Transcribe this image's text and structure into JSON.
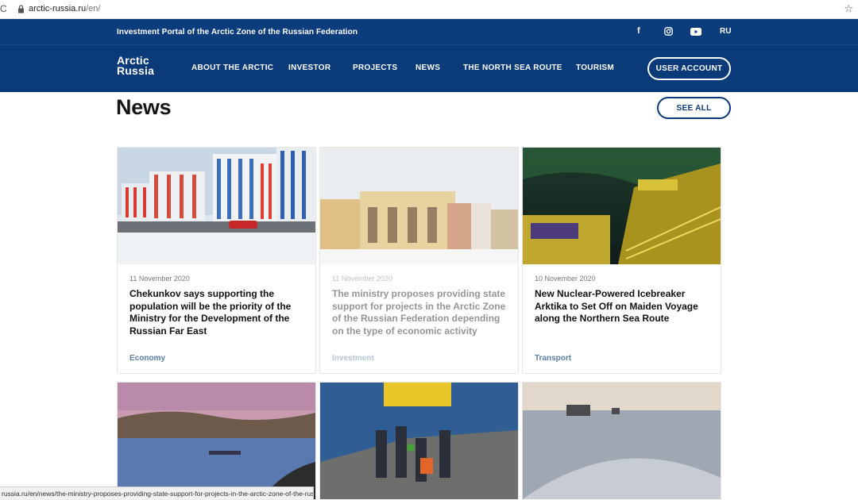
{
  "browser": {
    "url_host": "arctic-russia.ru",
    "url_path": "/en/",
    "status_url": "russia.ru/en/news/the-ministry-proposes-providing-state-support-for-projects-in-the-arctic-zone-of-the-russian-federat/"
  },
  "header": {
    "portal_title": "Investment Portal of the Arctic Zone of the Russian Federation",
    "social": [
      "f",
      "instagram-icon",
      "youtube-icon"
    ],
    "lang": "RU",
    "logo_line1": "Arctic",
    "logo_line2": "Russia",
    "nav": [
      {
        "label": "ABOUT THE ARCTIC"
      },
      {
        "label": "INVESTOR"
      },
      {
        "label": "PROJECTS"
      },
      {
        "label": "NEWS"
      },
      {
        "label": "THE NORTH SEA ROUTE"
      },
      {
        "label": "TOURISM"
      }
    ],
    "account_label": "USER ACCOUNT",
    "colors": {
      "header_bg": "#0a3a78",
      "tag": "#5b7ea3"
    }
  },
  "news": {
    "title": "News",
    "see_all": "SEE ALL",
    "cards": [
      {
        "date": "11 November 2020",
        "title": "Chekunkov says supporting the population will be the priority of the Ministry for the Development of the Russian Far East",
        "tag": "Economy"
      },
      {
        "date": "11 November 2020",
        "title": "The ministry proposes providing state support for projects in the Arctic Zone of the Russian Federation depending on the type of economic activity",
        "tag": "Investment"
      },
      {
        "date": "10 November 2020",
        "title": "New Nuclear-Powered Icebreaker Arktika to Set Off on Maiden Voyage along the Northern Sea Route",
        "tag": "Transport"
      }
    ]
  }
}
